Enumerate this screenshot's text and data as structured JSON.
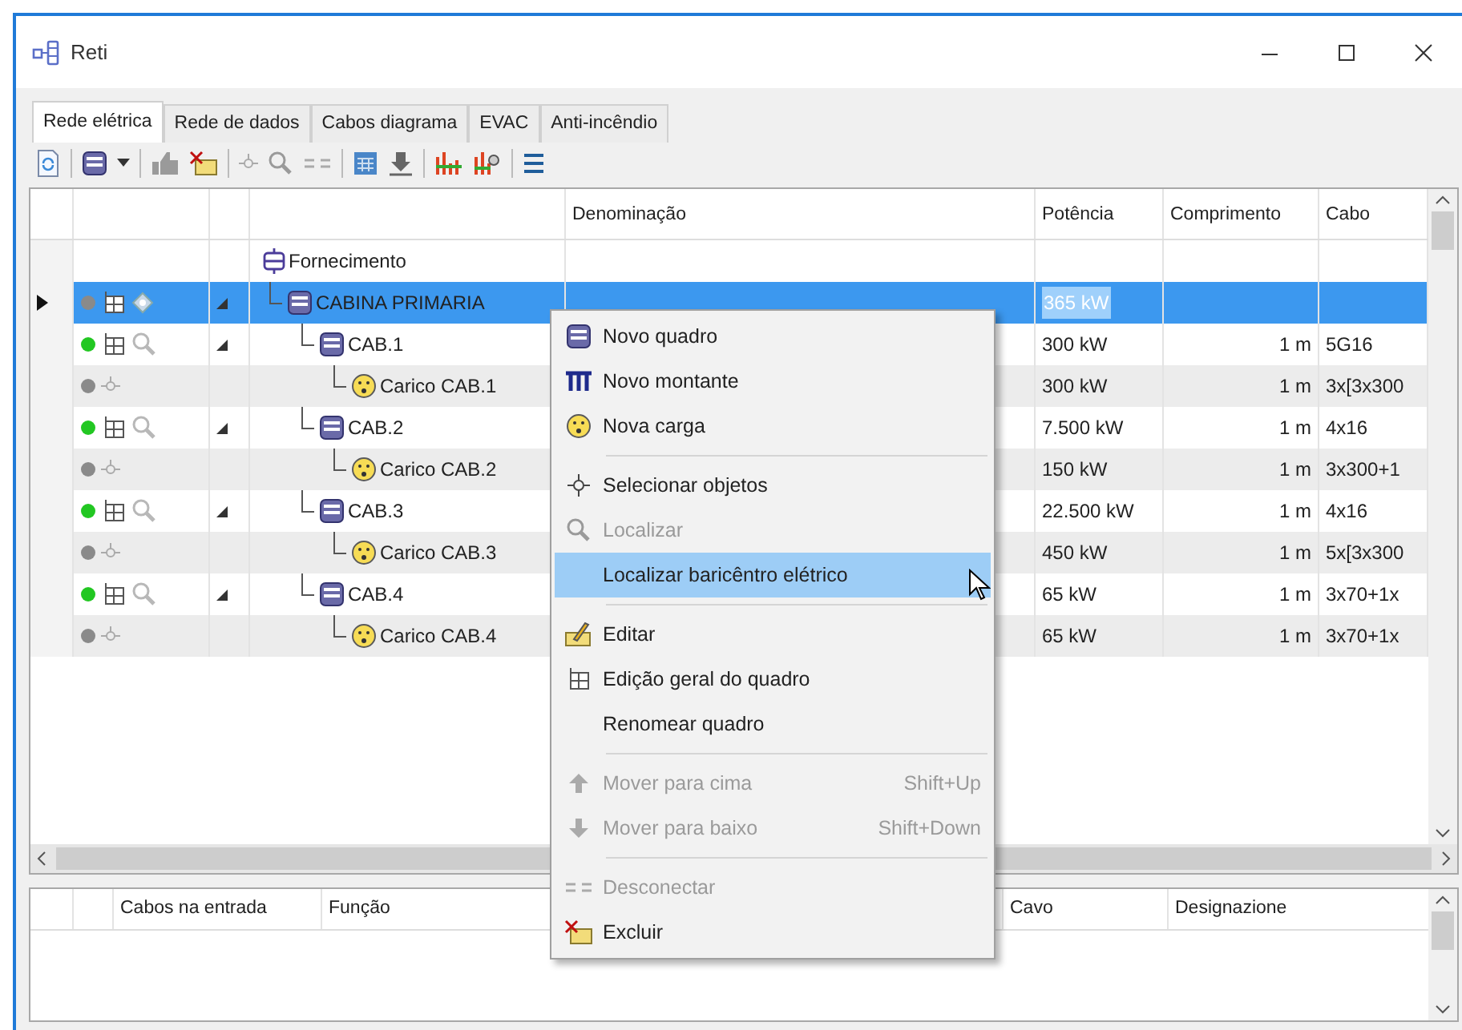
{
  "window": {
    "title": "Reti"
  },
  "tabs": [
    {
      "label": "Rede elétrica",
      "selected": true
    },
    {
      "label": "Rede de dados",
      "selected": false
    },
    {
      "label": "Cabos diagrama",
      "selected": false
    },
    {
      "label": "EVAC",
      "selected": false
    },
    {
      "label": "Anti-incêndio",
      "selected": false
    }
  ],
  "table": {
    "columns": [
      "Denominação",
      "Potência",
      "Comprimento",
      "Cabo"
    ],
    "rows": [
      {
        "name": "Fornecimento",
        "kind": "supply",
        "selected": false,
        "children": [
          {
            "name": "CABINA PRIMARIA",
            "kind": "main",
            "selected": true,
            "color": "#8a8a8a",
            "power": "365 kW",
            "children": [
              {
                "name": "CAB.1",
                "kind": "board",
                "selected": false,
                "color": "#22c722",
                "power": "300 kW",
                "length": "1 m",
                "cable": "5G16",
                "children": [
                  {
                    "name": "Carico CAB.1",
                    "kind": "load",
                    "selected": false,
                    "color": "#8a8a8a",
                    "power": "300 kW",
                    "length": "1 m",
                    "cable": "3x[3x300"
                  }
                ]
              },
              {
                "name": "CAB.2",
                "kind": "board",
                "selected": false,
                "color": "#22c722",
                "power": "7.500 kW",
                "length": "1 m",
                "cable": "4x16",
                "children": [
                  {
                    "name": "Carico CAB.2",
                    "kind": "load",
                    "selected": false,
                    "color": "#8a8a8a",
                    "power": "150 kW",
                    "length": "1 m",
                    "cable": "3x300+1"
                  }
                ]
              },
              {
                "name": "CAB.3",
                "kind": "board",
                "selected": false,
                "color": "#22c722",
                "power": "22.500 kW",
                "length": "1 m",
                "cable": "4x16",
                "children": [
                  {
                    "name": "Carico CAB.3",
                    "kind": "load",
                    "selected": false,
                    "color": "#8a8a8a",
                    "power": "450 kW",
                    "length": "1 m",
                    "cable": "5x[3x300"
                  }
                ]
              },
              {
                "name": "CAB.4",
                "kind": "board",
                "selected": false,
                "color": "#22c722",
                "power": "65 kW",
                "length": "1 m",
                "cable": "3x70+1x",
                "children": [
                  {
                    "name": "Carico CAB.4",
                    "kind": "load",
                    "selected": false,
                    "color": "#8a8a8a",
                    "power": "65 kW",
                    "length": "1 m",
                    "cable": "3x70+1x"
                  }
                ]
              }
            ]
          }
        ]
      }
    ]
  },
  "context_menu": {
    "groups": [
      [
        {
          "label": "Novo quadro",
          "disabled": false,
          "selected": false
        },
        {
          "label": "Novo montante",
          "disabled": false,
          "selected": false
        },
        {
          "label": "Nova carga",
          "disabled": false,
          "selected": false
        }
      ],
      [
        {
          "label": "Selecionar objetos",
          "disabled": false,
          "selected": false
        },
        {
          "label": "Localizar",
          "disabled": true,
          "selected": false
        },
        {
          "label": "Localizar baricêntro elétrico",
          "disabled": false,
          "selected": true
        }
      ],
      [
        {
          "label": "Editar",
          "disabled": false,
          "selected": false
        },
        {
          "label": "Edição geral do quadro",
          "disabled": false,
          "selected": false
        },
        {
          "label": "Renomear quadro",
          "disabled": false,
          "selected": false
        }
      ],
      [
        {
          "label": "Mover para cima",
          "shortcut": "Shift+Up",
          "disabled": true,
          "selected": false
        },
        {
          "label": "Mover para baixo",
          "shortcut": "Shift+Down",
          "disabled": true,
          "selected": false
        }
      ],
      [
        {
          "label": "Desconectar",
          "disabled": true,
          "selected": false
        },
        {
          "label": "Excluir",
          "disabled": false,
          "selected": false
        }
      ]
    ]
  },
  "lower_panel": {
    "columns": [
      "Cabos na entrada",
      "Função",
      "Cavo",
      "Designazione"
    ]
  }
}
